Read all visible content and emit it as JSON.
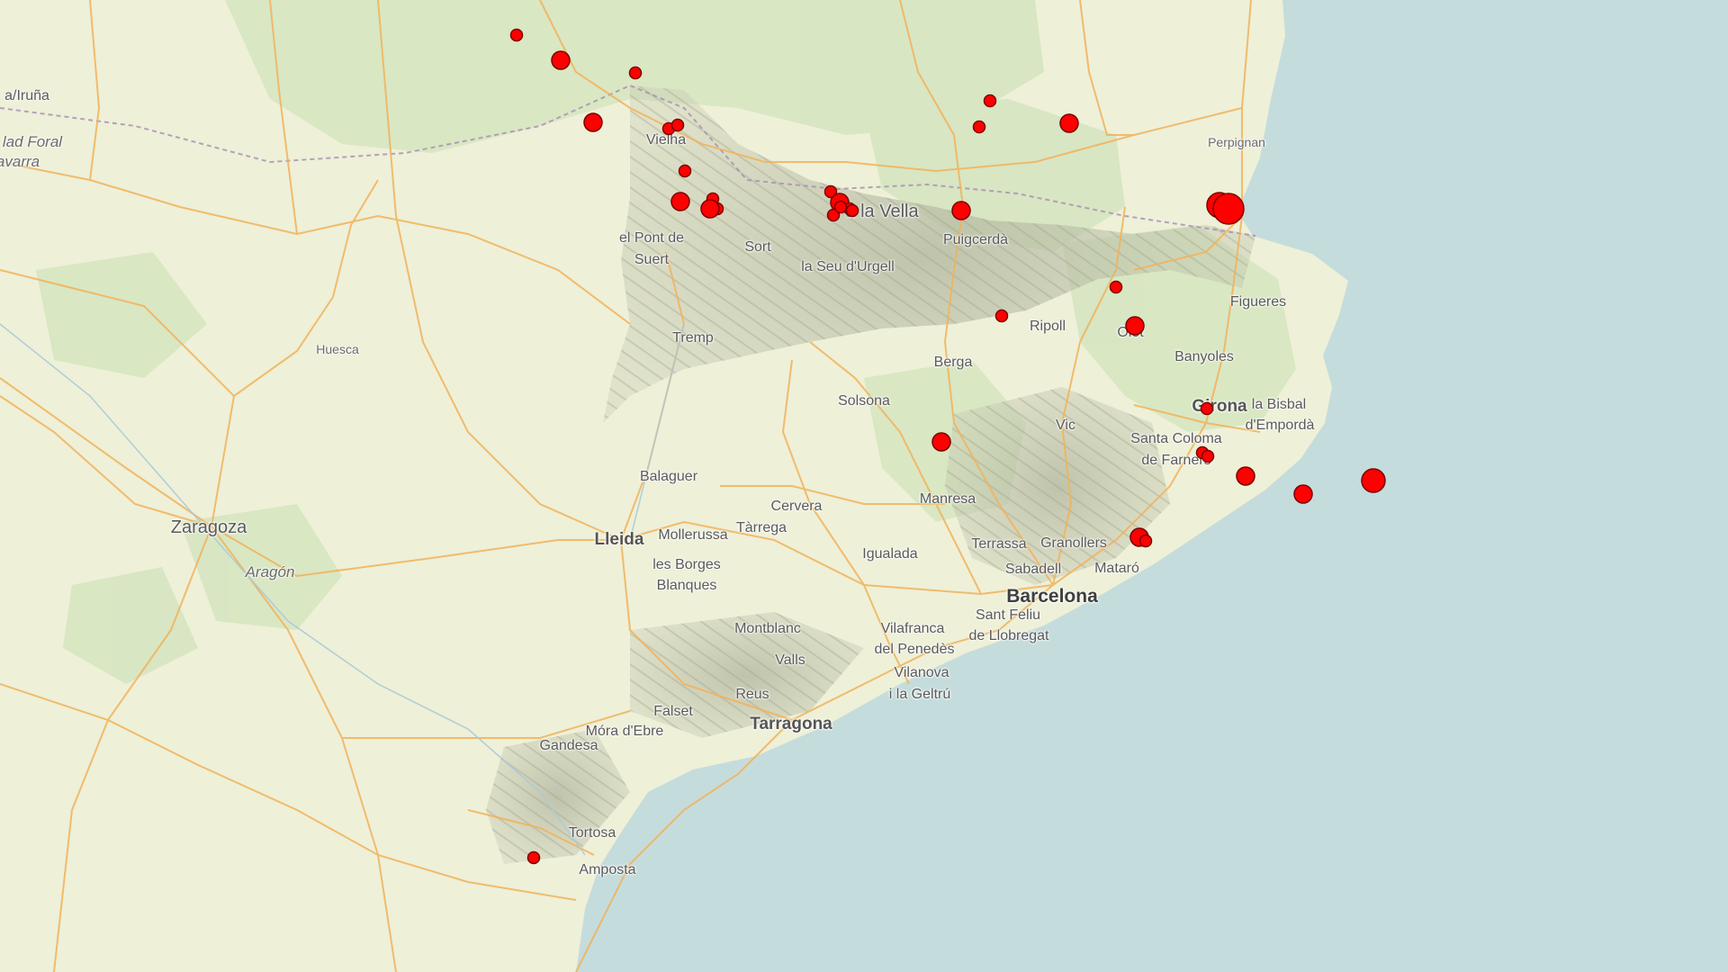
{
  "map": {
    "colors": {
      "sea": "#c5dcdc",
      "land": "#eef0d8",
      "forest": "#d7e6c3",
      "mountains": "#bfc3ad",
      "roads": "#f4b45a",
      "quake_fill": "#ff0000",
      "quake_stroke": "#7a0000"
    },
    "labels": [
      {
        "name": "label-pamplona",
        "text": "a/Iruña",
        "cls": "city"
      },
      {
        "name": "label-navarra-1",
        "text": "lad Foral",
        "cls": "region"
      },
      {
        "name": "label-navarra-2",
        "text": "avarra",
        "cls": "region"
      },
      {
        "name": "label-vielha",
        "text": "Vielha",
        "cls": ""
      },
      {
        "name": "label-pont-de-suert-1",
        "text": "el Pont de",
        "cls": ""
      },
      {
        "name": "label-pont-de-suert-2",
        "text": "Suert",
        "cls": ""
      },
      {
        "name": "label-sort",
        "text": "Sort",
        "cls": ""
      },
      {
        "name": "label-andorra-la-vella",
        "text": "a la Vella",
        "cls": "city"
      },
      {
        "name": "label-seu-urgell",
        "text": "la Seu d'Urgell",
        "cls": ""
      },
      {
        "name": "label-puigcerda",
        "text": "Puigcerdà",
        "cls": ""
      },
      {
        "name": "label-perpignan",
        "text": "Perpignan",
        "cls": "small"
      },
      {
        "name": "label-figueres",
        "text": "Figueres",
        "cls": ""
      },
      {
        "name": "label-tremp",
        "text": "Tremp",
        "cls": ""
      },
      {
        "name": "label-ripoll",
        "text": "Ripoll",
        "cls": ""
      },
      {
        "name": "label-olot",
        "text": "Olot",
        "cls": ""
      },
      {
        "name": "label-banyoles",
        "text": "Banyoles",
        "cls": ""
      },
      {
        "name": "label-huesca",
        "text": "Huesca",
        "cls": "small"
      },
      {
        "name": "label-berga",
        "text": "Berga",
        "cls": ""
      },
      {
        "name": "label-solsona",
        "text": "Solsona",
        "cls": ""
      },
      {
        "name": "label-girona",
        "text": "Girona",
        "cls": "medium"
      },
      {
        "name": "label-la-bisbal-1",
        "text": "la Bisbal",
        "cls": ""
      },
      {
        "name": "label-la-bisbal-2",
        "text": "d'Empordà",
        "cls": ""
      },
      {
        "name": "label-vic",
        "text": "Vic",
        "cls": ""
      },
      {
        "name": "label-santa-coloma-1",
        "text": "Santa Coloma",
        "cls": ""
      },
      {
        "name": "label-santa-coloma-2",
        "text": "de Farners",
        "cls": ""
      },
      {
        "name": "label-balaguer",
        "text": "Balaguer",
        "cls": ""
      },
      {
        "name": "label-manresa",
        "text": "Manresa",
        "cls": ""
      },
      {
        "name": "label-cervera",
        "text": "Cervera",
        "cls": ""
      },
      {
        "name": "label-zaragoza",
        "text": "Zaragoza",
        "cls": "city"
      },
      {
        "name": "label-lleida",
        "text": "Lleida",
        "cls": "medium"
      },
      {
        "name": "label-mollerussa",
        "text": "Mollerussa",
        "cls": ""
      },
      {
        "name": "label-tarrega",
        "text": "Tàrrega",
        "cls": ""
      },
      {
        "name": "label-terrassa",
        "text": "Terrassa",
        "cls": ""
      },
      {
        "name": "label-granollers",
        "text": "Granollers",
        "cls": ""
      },
      {
        "name": "label-igualada",
        "text": "Igualada",
        "cls": ""
      },
      {
        "name": "label-aragon",
        "text": "Aragón",
        "cls": "region"
      },
      {
        "name": "label-sabadell",
        "text": "Sabadell",
        "cls": ""
      },
      {
        "name": "label-mataro",
        "text": "Mataró",
        "cls": ""
      },
      {
        "name": "label-les-borges-1",
        "text": "les Borges",
        "cls": ""
      },
      {
        "name": "label-les-borges-2",
        "text": "Blanques",
        "cls": ""
      },
      {
        "name": "label-barcelona",
        "text": "Barcelona",
        "cls": "major"
      },
      {
        "name": "label-sant-feliu-1",
        "text": "Sant Feliu",
        "cls": ""
      },
      {
        "name": "label-sant-feliu-2",
        "text": "de Llobregat",
        "cls": ""
      },
      {
        "name": "label-montblanc",
        "text": "Montblanc",
        "cls": ""
      },
      {
        "name": "label-vilafranca-1",
        "text": "Vilafranca",
        "cls": ""
      },
      {
        "name": "label-vilafranca-2",
        "text": "del Penedès",
        "cls": ""
      },
      {
        "name": "label-valls",
        "text": "Valls",
        "cls": ""
      },
      {
        "name": "label-vilanova-1",
        "text": "Vilanova",
        "cls": ""
      },
      {
        "name": "label-vilanova-2",
        "text": "i la Geltrú",
        "cls": ""
      },
      {
        "name": "label-reus",
        "text": "Reus",
        "cls": ""
      },
      {
        "name": "label-falset",
        "text": "Falset",
        "cls": ""
      },
      {
        "name": "label-tarragona",
        "text": "Tarragona",
        "cls": "medium"
      },
      {
        "name": "label-mora-debre",
        "text": "Móra d'Ebre",
        "cls": ""
      },
      {
        "name": "label-gandesa",
        "text": "Gandesa",
        "cls": ""
      },
      {
        "name": "label-tortosa",
        "text": "Tortosa",
        "cls": ""
      },
      {
        "name": "label-amposta",
        "text": "Amposta",
        "cls": ""
      }
    ],
    "earthquake_markers_count_visible": 42
  }
}
